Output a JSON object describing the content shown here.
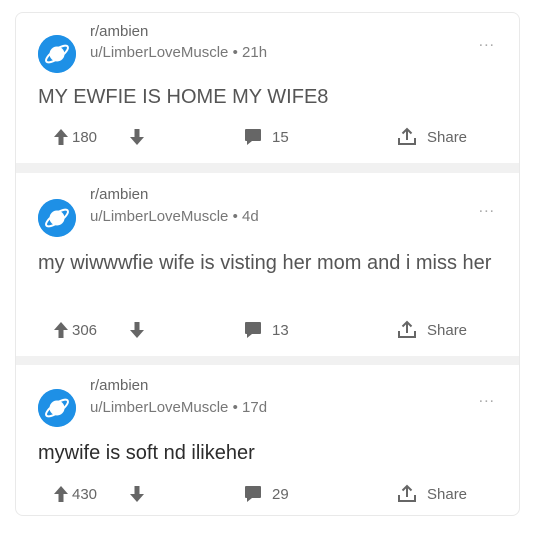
{
  "colors": {
    "accent": "#1e90e6",
    "text": "#555555",
    "divider": "#f1f1f1"
  },
  "icons": {
    "vote_up": "arrow-up-icon",
    "vote_down": "arrow-down-icon",
    "comments": "comment-bubble-icon",
    "share": "share-icon",
    "more": "more-options-icon"
  },
  "posts": [
    {
      "subreddit": "r/ambien",
      "user": "u/LimberLoveMuscle",
      "age": "21h",
      "separator": "•",
      "more": "...",
      "title": "MY EWFIE IS HOME MY WIFE8",
      "score": "180",
      "comments": "15",
      "share": "Share"
    },
    {
      "subreddit": "r/ambien",
      "user": "u/LimberLoveMuscle",
      "age": "4d",
      "separator": "•",
      "more": "...",
      "title": "my wiwwwfie wife is visting her mom and i miss her",
      "score": "306",
      "comments": "13",
      "share": "Share"
    },
    {
      "subreddit": "r/ambien",
      "user": "u/LimberLoveMuscle",
      "age": "17d",
      "separator": "•",
      "more": "...",
      "title": "mywife is soft nd ilikeher",
      "score": "430",
      "comments": "29",
      "share": "Share"
    }
  ]
}
